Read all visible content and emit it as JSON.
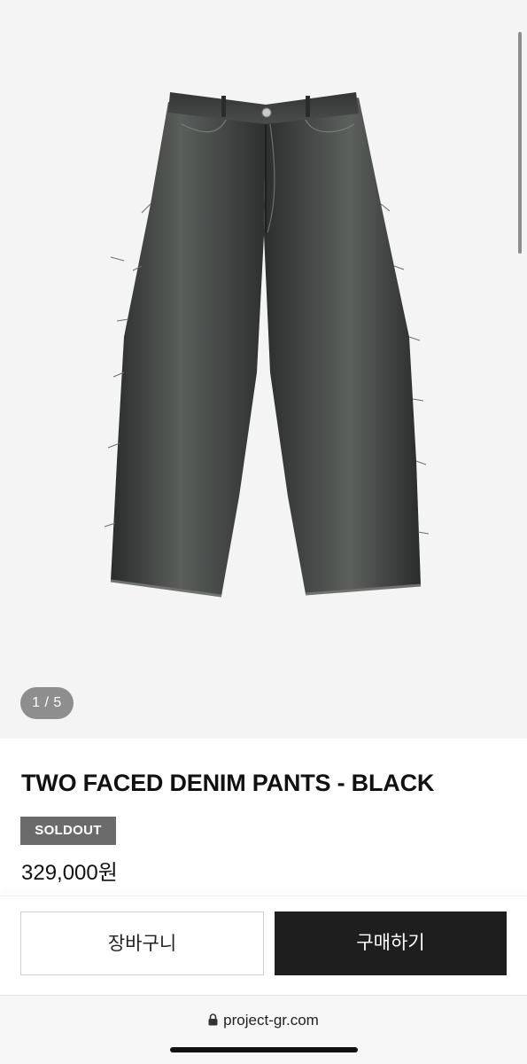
{
  "gallery": {
    "counter": "1 / 5",
    "image_subject": "black wide-leg denim pants with frayed side seams"
  },
  "product": {
    "title": "TWO FACED DENIM PANTS - BLACK",
    "status_badge": "SOLDOUT",
    "price": "329,000원"
  },
  "actions": {
    "cart_label": "장바구니",
    "buy_label": "구매하기"
  },
  "browser": {
    "url": "project-gr.com",
    "lock_icon": "lock-icon"
  },
  "colors": {
    "buy_button": "#1e1e1e",
    "badge": "#6b6b6b",
    "gallery_bg": "#f4f4f4"
  }
}
